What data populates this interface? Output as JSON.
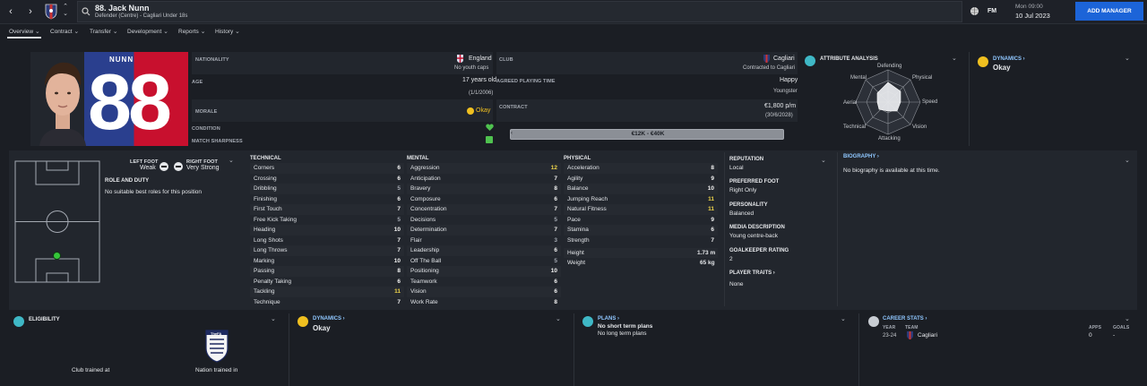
{
  "topbar": {
    "player_title": "88. Jack Nunn",
    "player_subtitle": "Defender (Centre) - Cagliari Under 18s",
    "fm_label": "FM",
    "date_day": "Mon 09:00",
    "date_full": "10 Jul 2023",
    "add_manager": "ADD MANAGER"
  },
  "tabs": [
    "Overview",
    "Contract",
    "Transfer",
    "Development",
    "Reports",
    "History"
  ],
  "profile": {
    "shirt_name": "NUNN",
    "shirt_number": "88",
    "nationality_label": "NATIONALITY",
    "nationality": "England",
    "youth_caps": "No youth caps",
    "age_label": "AGE",
    "age": "17 years old",
    "dob": "(1/1/2006)",
    "morale_label": "MORALE",
    "morale": "Okay",
    "condition_label": "CONDITION",
    "sharpness_label": "MATCH SHARPNESS",
    "club_label": "CLUB",
    "club": "Cagliari",
    "contracted": "Contracted to Cagliari",
    "playing_time_label": "AGREED PLAYING TIME",
    "playing_time": "Happy",
    "playing_time_status": "Youngster",
    "contract_label": "CONTRACT",
    "wage": "€1,800 p/m",
    "contract_end": "(30/6/2028)",
    "value_range": "€12K - €40K"
  },
  "attribute_analysis": {
    "title": "ATTRIBUTE ANALYSIS",
    "axes": [
      "Defending",
      "Physical",
      "Speed",
      "Vision",
      "Attacking",
      "Technical",
      "Aerial",
      "Mental"
    ]
  },
  "dynamics_top": {
    "title": "DYNAMICS",
    "value": "Okay"
  },
  "feet": {
    "left_label": "LEFT FOOT",
    "left_value": "Weak",
    "right_label": "RIGHT FOOT",
    "right_value": "Very Strong"
  },
  "role": {
    "title": "ROLE AND DUTY",
    "text": "No suitable best roles for this position"
  },
  "technical": {
    "title": "TECHNICAL",
    "rows": [
      [
        "Corners",
        "6"
      ],
      [
        "Crossing",
        "6"
      ],
      [
        "Dribbling",
        "5"
      ],
      [
        "Finishing",
        "6"
      ],
      [
        "First Touch",
        "7"
      ],
      [
        "Free Kick Taking",
        "5"
      ],
      [
        "Heading",
        "10"
      ],
      [
        "Long Shots",
        "7"
      ],
      [
        "Long Throws",
        "7"
      ],
      [
        "Marking",
        "10"
      ],
      [
        "Passing",
        "8"
      ],
      [
        "Penalty Taking",
        "6"
      ],
      [
        "Tackling",
        "11"
      ],
      [
        "Technique",
        "7"
      ]
    ]
  },
  "mental": {
    "title": "MENTAL",
    "rows": [
      [
        "Aggression",
        "12"
      ],
      [
        "Anticipation",
        "7"
      ],
      [
        "Bravery",
        "8"
      ],
      [
        "Composure",
        "6"
      ],
      [
        "Concentration",
        "7"
      ],
      [
        "Decisions",
        "5"
      ],
      [
        "Determination",
        "7"
      ],
      [
        "Flair",
        "3"
      ],
      [
        "Leadership",
        "6"
      ],
      [
        "Off The Ball",
        "5"
      ],
      [
        "Positioning",
        "10"
      ],
      [
        "Teamwork",
        "6"
      ],
      [
        "Vision",
        "6"
      ],
      [
        "Work Rate",
        "8"
      ]
    ]
  },
  "physical": {
    "title": "PHYSICAL",
    "rows": [
      [
        "Acceleration",
        "8"
      ],
      [
        "Agility",
        "9"
      ],
      [
        "Balance",
        "10"
      ],
      [
        "Jumping Reach",
        "11"
      ],
      [
        "Natural Fitness",
        "11"
      ],
      [
        "Pace",
        "9"
      ],
      [
        "Stamina",
        "6"
      ],
      [
        "Strength",
        "7"
      ]
    ],
    "height_label": "Height",
    "height": "1.73 m",
    "weight_label": "Weight",
    "weight": "65 kg"
  },
  "info": {
    "reputation_label": "REPUTATION",
    "reputation": "Local",
    "foot_label": "PREFERRED FOOT",
    "foot": "Right Only",
    "personality_label": "PERSONALITY",
    "personality": "Balanced",
    "media_label": "MEDIA DESCRIPTION",
    "media": "Young centre-back",
    "gk_label": "GOALKEEPER RATING",
    "gk": "2",
    "traits_label": "PLAYER TRAITS",
    "traits": "None"
  },
  "biography": {
    "title": "BIOGRAPHY",
    "text": "No biography is available at this time."
  },
  "eligibility": {
    "title": "ELIGIBILITY",
    "club_trained": "Club trained at",
    "nation_trained": "Nation trained in",
    "fa_label": "TheFA"
  },
  "dynamics_bottom": {
    "title": "DYNAMICS",
    "value": "Okay"
  },
  "plans": {
    "title": "PLANS",
    "short": "No short term plans",
    "long": "No long term plans"
  },
  "career": {
    "title": "CAREER STATS",
    "col_year": "YEAR",
    "col_team": "TEAM",
    "col_apps": "APPS",
    "col_goals": "GOALS",
    "year": "23-24",
    "team": "Cagliari",
    "apps": "0",
    "goals": "-"
  },
  "colors": {
    "accent": "#1c64d8",
    "okay": "#f0c020",
    "green": "#4fc24f",
    "link": "#8fc7ff"
  }
}
